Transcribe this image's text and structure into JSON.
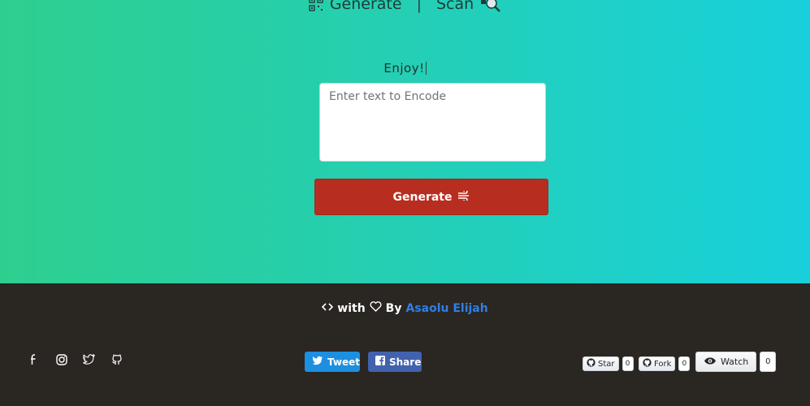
{
  "nav": {
    "generate_label": "Generate",
    "separator": "|",
    "scan_label": "Scan"
  },
  "main": {
    "enjoy_text": "Enjoy!",
    "input_placeholder": "Enter text to Encode",
    "input_value": "",
    "generate_button_label": "Generate"
  },
  "footer": {
    "credit_with": "with",
    "credit_by": "By",
    "author_name": "Asaolu Elijah",
    "socials": [
      "facebook-icon",
      "instagram-icon",
      "twitter-icon",
      "github-icon"
    ],
    "tweet_label": "Tweet",
    "share_label": "Share",
    "github": {
      "star_label": "Star",
      "star_count": "0",
      "fork_label": "Fork",
      "fork_count": "0",
      "watch_label": "Watch",
      "watch_count": "0"
    }
  },
  "colors": {
    "gradient_start": "#2ecf8e",
    "gradient_end": "#18d0dc",
    "generate_button": "#b72e21",
    "footer_bg": "#2a2622",
    "author_link": "#2f7fe6",
    "tweet": "#1d8fe0",
    "facebook": "#4262ad"
  }
}
